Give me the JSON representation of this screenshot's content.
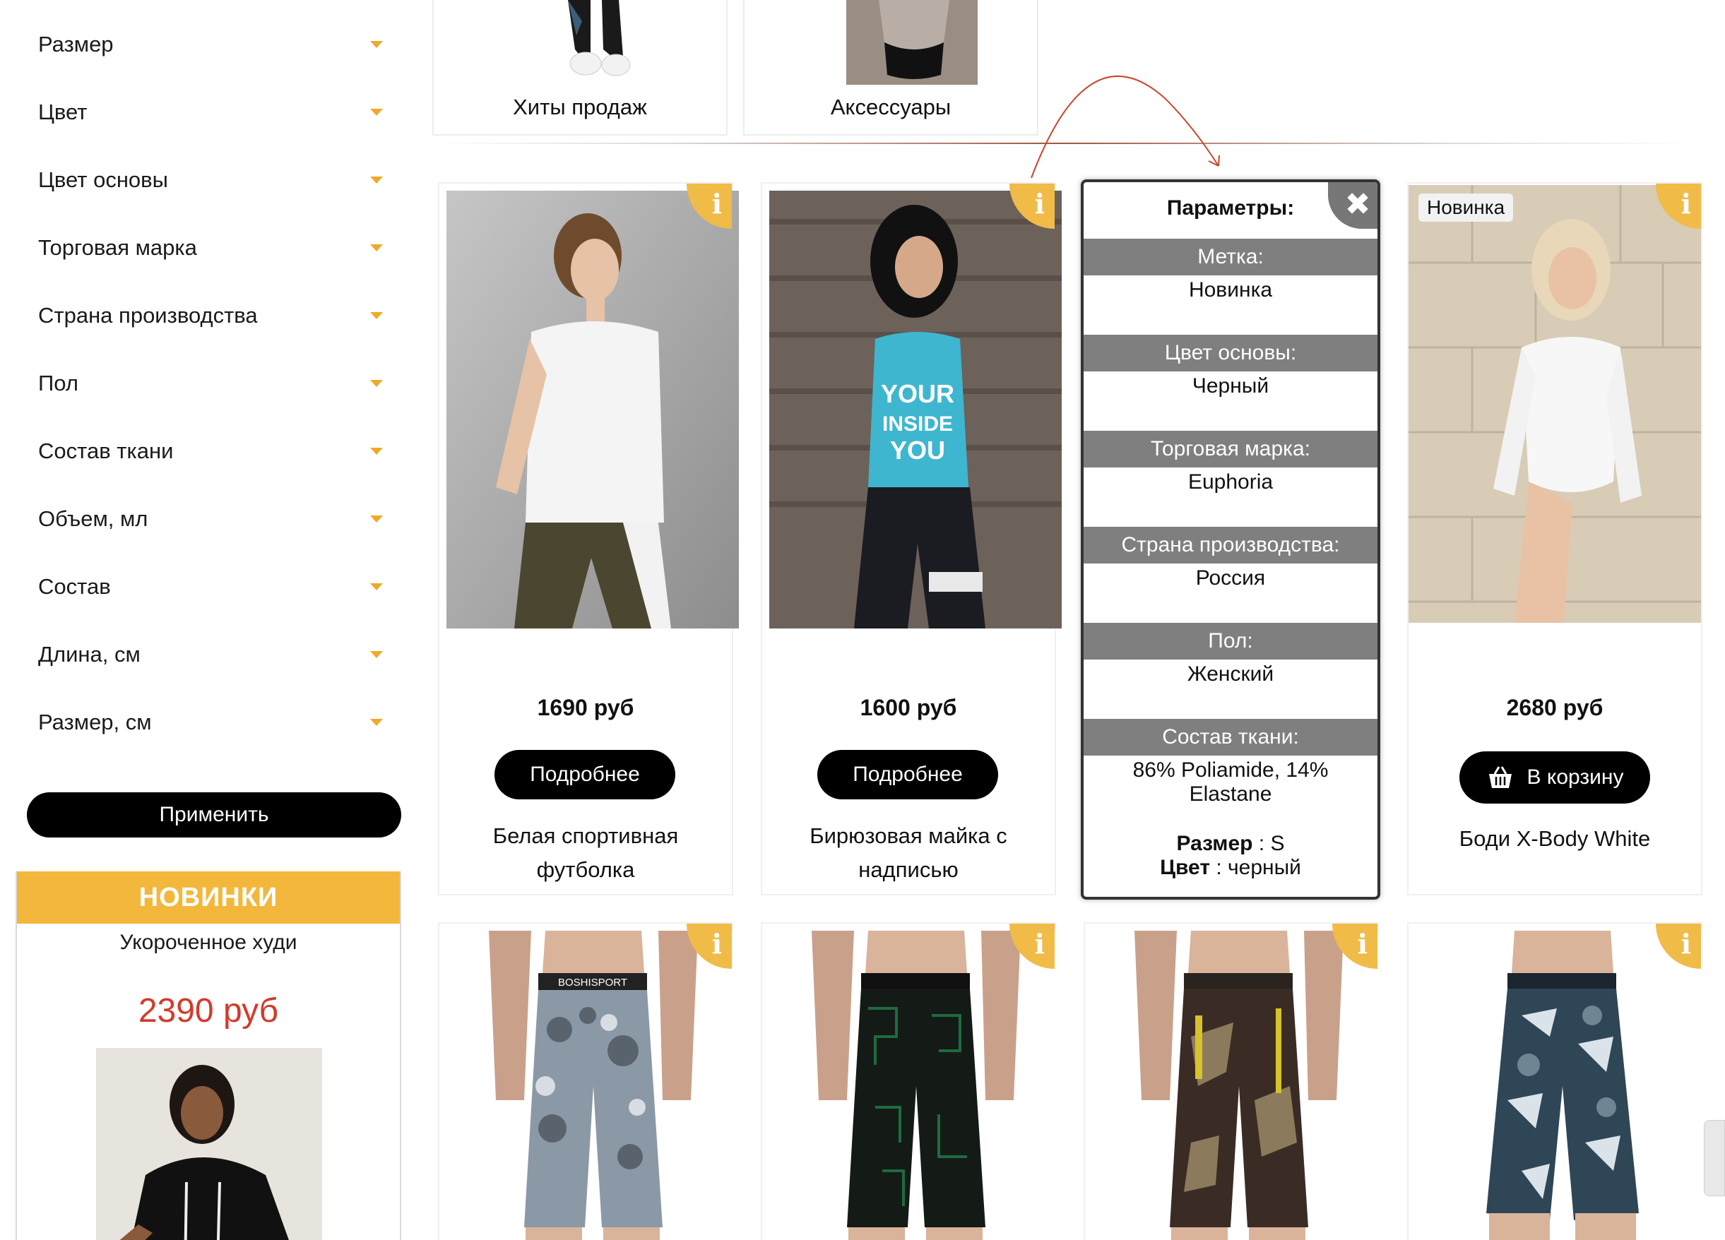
{
  "filters": [
    {
      "label": "Размер"
    },
    {
      "label": "Цвет"
    },
    {
      "label": "Цвет основы"
    },
    {
      "label": "Торговая марка"
    },
    {
      "label": "Страна производства"
    },
    {
      "label": "Пол"
    },
    {
      "label": "Состав ткани"
    },
    {
      "label": "Объем, мл"
    },
    {
      "label": "Состав"
    },
    {
      "label": "Длина, см"
    },
    {
      "label": "Размер, см"
    }
  ],
  "apply_label": "Применить",
  "new_box": {
    "header": "НОВИНКИ",
    "title": "Укороченное худи",
    "price": "2390 руб"
  },
  "categories": [
    {
      "label": "Хиты продаж"
    },
    {
      "label": "Аксессуары"
    }
  ],
  "products": [
    {
      "price": "1690 руб",
      "button": "Подробнее",
      "name": "Белая спортивная футболка",
      "info_icon": "i"
    },
    {
      "price": "1600 руб",
      "button": "Подробнее",
      "name": "Бирюзовая майка с надписью",
      "info_icon": "i"
    },
    {
      "price": "2680 руб",
      "button": "В корзину",
      "name": "Боди X-Body White",
      "tag": "Новинка",
      "info_icon": "i"
    }
  ],
  "popup": {
    "title": "Параметры:",
    "close_icon": "✖",
    "params": [
      {
        "name": "Метка:",
        "value": "Новинка"
      },
      {
        "name": "Цвет основы:",
        "value": "Черный"
      },
      {
        "name": "Торговая марка:",
        "value": "Euphoria"
      },
      {
        "name": "Страна производства:",
        "value": "Россия"
      },
      {
        "name": "Пол:",
        "value": "Женский"
      },
      {
        "name": "Состав ткани:",
        "value": "86% Poliamide, 14% Elastane"
      }
    ],
    "size_label": "Размер",
    "size_value": ": S",
    "color_label": "Цвет",
    "color_value": ": черный"
  },
  "icons": {
    "caret": "caret-down-icon",
    "info": "info-icon",
    "cart": "basket-icon",
    "close": "close-icon"
  },
  "colors": {
    "accent": "#f0bb47",
    "price_red": "#d43a2a",
    "button": "#000000",
    "param_header": "#7f7f7f"
  }
}
